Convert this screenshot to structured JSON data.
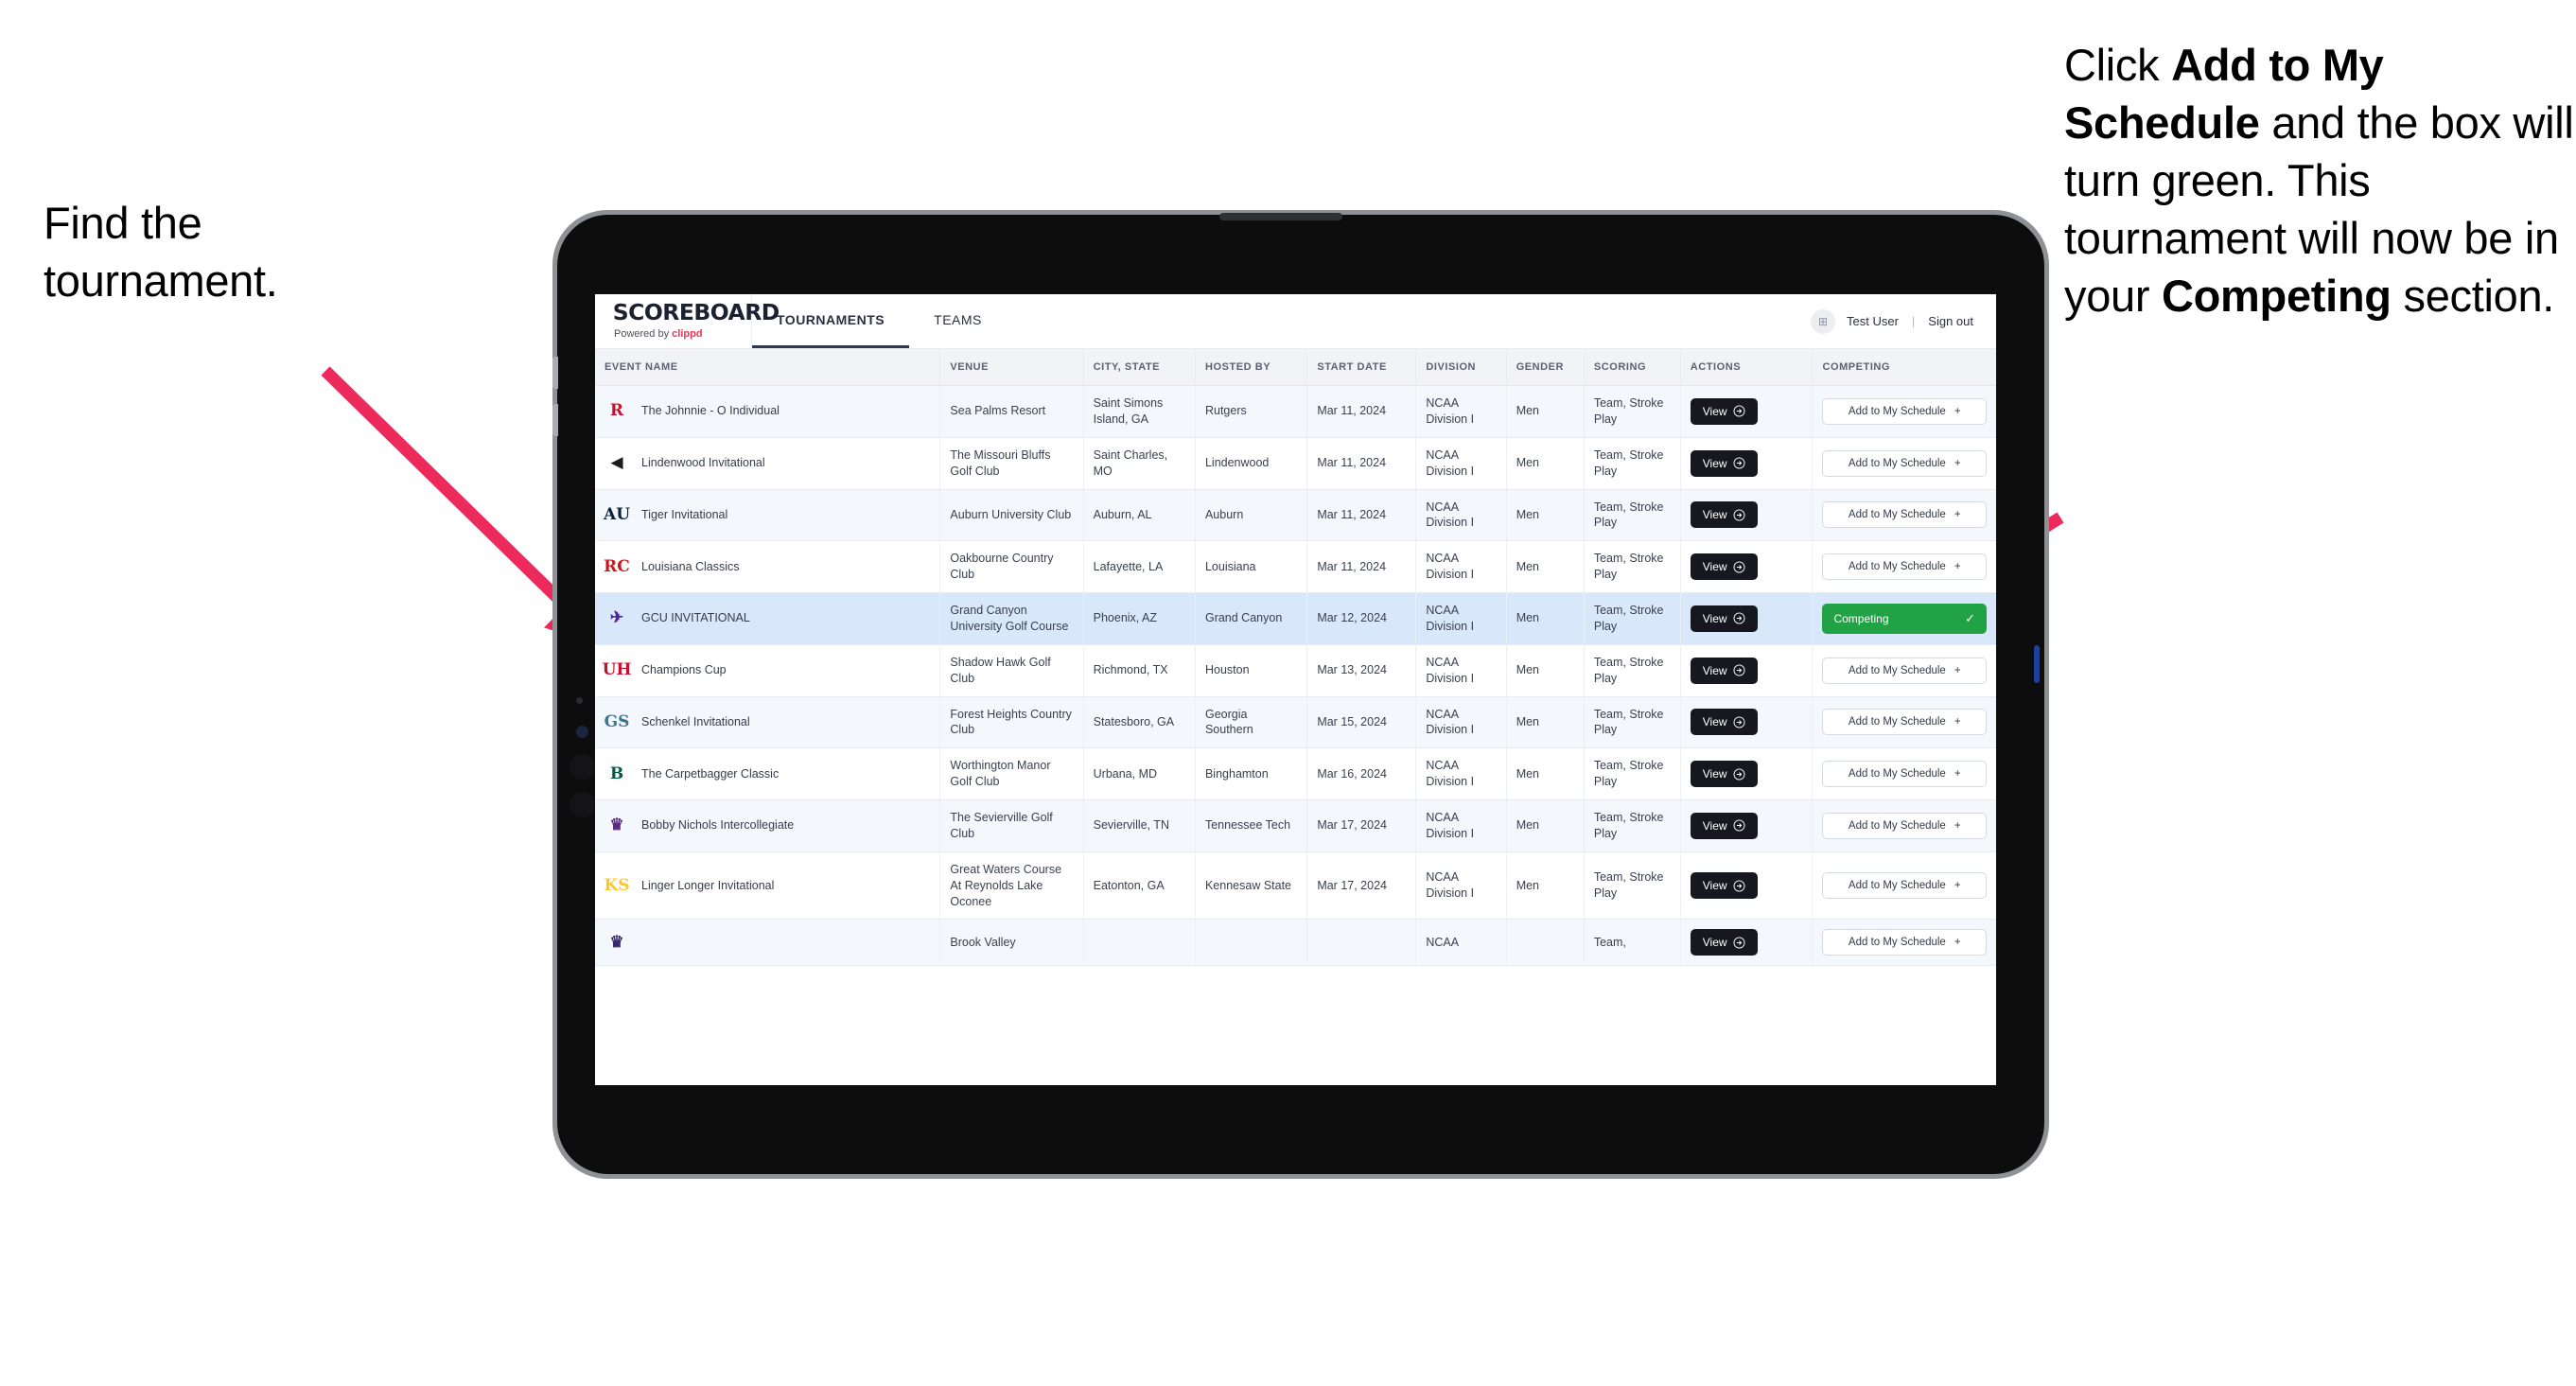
{
  "annotations": {
    "left": {
      "lines": [
        "Find the",
        "tournament."
      ]
    },
    "right": {
      "segments": [
        {
          "text": "Click ",
          "bold": false
        },
        {
          "text": "Add to My Schedule",
          "bold": true
        },
        {
          "text": " and the box will turn green. This tournament will now be in your ",
          "bold": false
        },
        {
          "text": "Competing",
          "bold": true
        },
        {
          "text": " section.",
          "bold": false
        }
      ]
    },
    "arrow_color": "#EC2A5B"
  },
  "app": {
    "brand": {
      "title": "SCOREBOARD",
      "powered_prefix": "Powered by ",
      "powered_name": "clippd"
    },
    "tabs": [
      {
        "label": "TOURNAMENTS",
        "active": true
      },
      {
        "label": "TEAMS",
        "active": false
      }
    ],
    "user": {
      "avatar_glyph": "⊞",
      "name": "Test User",
      "separator": "|",
      "signout": "Sign out"
    }
  },
  "table": {
    "columns": [
      "EVENT NAME",
      "VENUE",
      "CITY, STATE",
      "HOSTED BY",
      "START DATE",
      "DIVISION",
      "GENDER",
      "SCORING",
      "ACTIONS",
      "COMPETING"
    ],
    "action_label": "View",
    "add_label": "Add to My Schedule",
    "add_icon": "+",
    "competing_label": "Competing",
    "competing_icon": "✓",
    "rows": [
      {
        "event": "The Johnnie - O Individual",
        "logo": {
          "text": "R",
          "color": "#C8102E",
          "bg": "transparent"
        },
        "venue": "Sea Palms Resort",
        "city": "Saint Simons Island, GA",
        "host": "Rutgers",
        "date": "Mar 11, 2024",
        "division": "NCAA Division I",
        "gender": "Men",
        "scoring": "Team, Stroke Play",
        "competing": false
      },
      {
        "event": "Lindenwood Invitational",
        "logo": {
          "text": "◀",
          "color": "#1c1c1c",
          "bg": "transparent"
        },
        "venue": "The Missouri Bluffs Golf Club",
        "city": "Saint Charles, MO",
        "host": "Lindenwood",
        "date": "Mar 11, 2024",
        "division": "NCAA Division I",
        "gender": "Men",
        "scoring": "Team, Stroke Play",
        "competing": false
      },
      {
        "event": "Tiger Invitational",
        "logo": {
          "text": "AU",
          "color": "#0C2340",
          "bg": "transparent"
        },
        "venue": "Auburn University Club",
        "city": "Auburn, AL",
        "host": "Auburn",
        "date": "Mar 11, 2024",
        "division": "NCAA Division I",
        "gender": "Men",
        "scoring": "Team, Stroke Play",
        "competing": false
      },
      {
        "event": "Louisiana Classics",
        "logo": {
          "text": "RC",
          "color": "#CE181E",
          "bg": "transparent"
        },
        "venue": "Oakbourne Country Club",
        "city": "Lafayette, LA",
        "host": "Louisiana",
        "date": "Mar 11, 2024",
        "division": "NCAA Division I",
        "gender": "Men",
        "scoring": "Team, Stroke Play",
        "competing": false
      },
      {
        "event": "GCU INVITATIONAL",
        "logo": {
          "text": "✈",
          "color": "#522398",
          "bg": "transparent"
        },
        "venue": "Grand Canyon University Golf Course",
        "city": "Phoenix, AZ",
        "host": "Grand Canyon",
        "date": "Mar 12, 2024",
        "division": "NCAA Division I",
        "gender": "Men",
        "scoring": "Team, Stroke Play",
        "competing": true
      },
      {
        "event": "Champions Cup",
        "logo": {
          "text": "UH",
          "color": "#C8102E",
          "bg": "transparent"
        },
        "venue": "Shadow Hawk Golf Club",
        "city": "Richmond, TX",
        "host": "Houston",
        "date": "Mar 13, 2024",
        "division": "NCAA Division I",
        "gender": "Men",
        "scoring": "Team, Stroke Play",
        "competing": false
      },
      {
        "event": "Schenkel Invitational",
        "logo": {
          "text": "GS",
          "color": "#41748D",
          "bg": "transparent"
        },
        "venue": "Forest Heights Country Club",
        "city": "Statesboro, GA",
        "host": "Georgia Southern",
        "date": "Mar 15, 2024",
        "division": "NCAA Division I",
        "gender": "Men",
        "scoring": "Team, Stroke Play",
        "competing": false
      },
      {
        "event": "The Carpetbagger Classic",
        "logo": {
          "text": "B",
          "color": "#005A43",
          "bg": "transparent"
        },
        "venue": "Worthington Manor Golf Club",
        "city": "Urbana, MD",
        "host": "Binghamton",
        "date": "Mar 16, 2024",
        "division": "NCAA Division I",
        "gender": "Men",
        "scoring": "Team, Stroke Play",
        "competing": false
      },
      {
        "event": "Bobby Nichols Intercollegiate",
        "logo": {
          "text": "♛",
          "color": "#592C82",
          "bg": "transparent"
        },
        "venue": "The Sevierville Golf Club",
        "city": "Sevierville, TN",
        "host": "Tennessee Tech",
        "date": "Mar 17, 2024",
        "division": "NCAA Division I",
        "gender": "Men",
        "scoring": "Team, Stroke Play",
        "competing": false
      },
      {
        "event": "Linger Longer Invitational",
        "logo": {
          "text": "KS",
          "color": "#FFC72C",
          "bg": "transparent"
        },
        "venue": "Great Waters Course At Reynolds Lake Oconee",
        "city": "Eatonton, GA",
        "host": "Kennesaw State",
        "date": "Mar 17, 2024",
        "division": "NCAA Division I",
        "gender": "Men",
        "scoring": "Team, Stroke Play",
        "competing": false
      },
      {
        "event": "",
        "logo": {
          "text": "♛",
          "color": "#3B2A6B",
          "bg": "transparent"
        },
        "venue": "Brook Valley",
        "city": "",
        "host": "",
        "date": "",
        "division": "NCAA",
        "gender": "",
        "scoring": "Team,",
        "competing": false
      }
    ]
  }
}
